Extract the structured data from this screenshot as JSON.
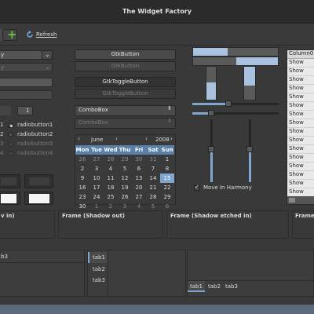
{
  "window": {
    "title": "The Widget Factory"
  },
  "toolbar": {
    "refresh_label": "Refresh"
  },
  "left": {
    "combo_text": "y",
    "spin_value": "1",
    "radios": [
      {
        "label": "radiobutton1"
      },
      {
        "label": "radiobutton2"
      },
      {
        "label": "radiobutton3"
      },
      {
        "label": "radiobutton4"
      }
    ],
    "frame_label": "v in)"
  },
  "buttons": {
    "gtkbutton": "GtkButton",
    "gtkbutton_dim": "GtkButton",
    "toggle": "GtkToggleButton",
    "toggle_dim": "GtkToggleButton",
    "combobox": "ComboBox",
    "combobox_dim": "ComboBox"
  },
  "calendar": {
    "month": "June",
    "year": "2008",
    "weekdays": [
      "Mon",
      "Tue",
      "Wed",
      "Thu",
      "Fri",
      "Sat",
      "Sun"
    ],
    "rows": [
      [
        "26",
        "27",
        "28",
        "29",
        "30",
        "31",
        "1"
      ],
      [
        "2",
        "3",
        "4",
        "5",
        "6",
        "7",
        "8"
      ],
      [
        "9",
        "10",
        "11",
        "12",
        "13",
        "14",
        "15"
      ],
      [
        "16",
        "17",
        "18",
        "19",
        "20",
        "21",
        "22"
      ],
      [
        "23",
        "24",
        "25",
        "26",
        "27",
        "28",
        "29"
      ],
      [
        "30",
        "1",
        "2",
        "3",
        "4",
        "5",
        "6"
      ]
    ],
    "selected": "15"
  },
  "harmony": {
    "label": "Move In Harmony",
    "checked": true
  },
  "treeview": {
    "column": "Column0",
    "rows": [
      "Show",
      "Show",
      "Show",
      "Show",
      "Show",
      "Show",
      "Show",
      "Show",
      "Show",
      "Show",
      "Show",
      "Show",
      "Show",
      "Show",
      "Show",
      "Show"
    ]
  },
  "frames": {
    "shadow_out": "Frame (Shadow out)",
    "shadow_etched_in": "Frame (Shadow etched in)",
    "last": "Frame"
  },
  "tabs_left": {
    "partial": "b3"
  },
  "tabs_vertical": [
    "tab1",
    "tab2",
    "tab3"
  ],
  "tabs_bottom": [
    "tab1",
    "tab2",
    "tab3"
  ],
  "colors": {
    "accent": "#7fa6cf",
    "window_bg": "#393939",
    "titlebar_bg": "#2b2b2b"
  }
}
